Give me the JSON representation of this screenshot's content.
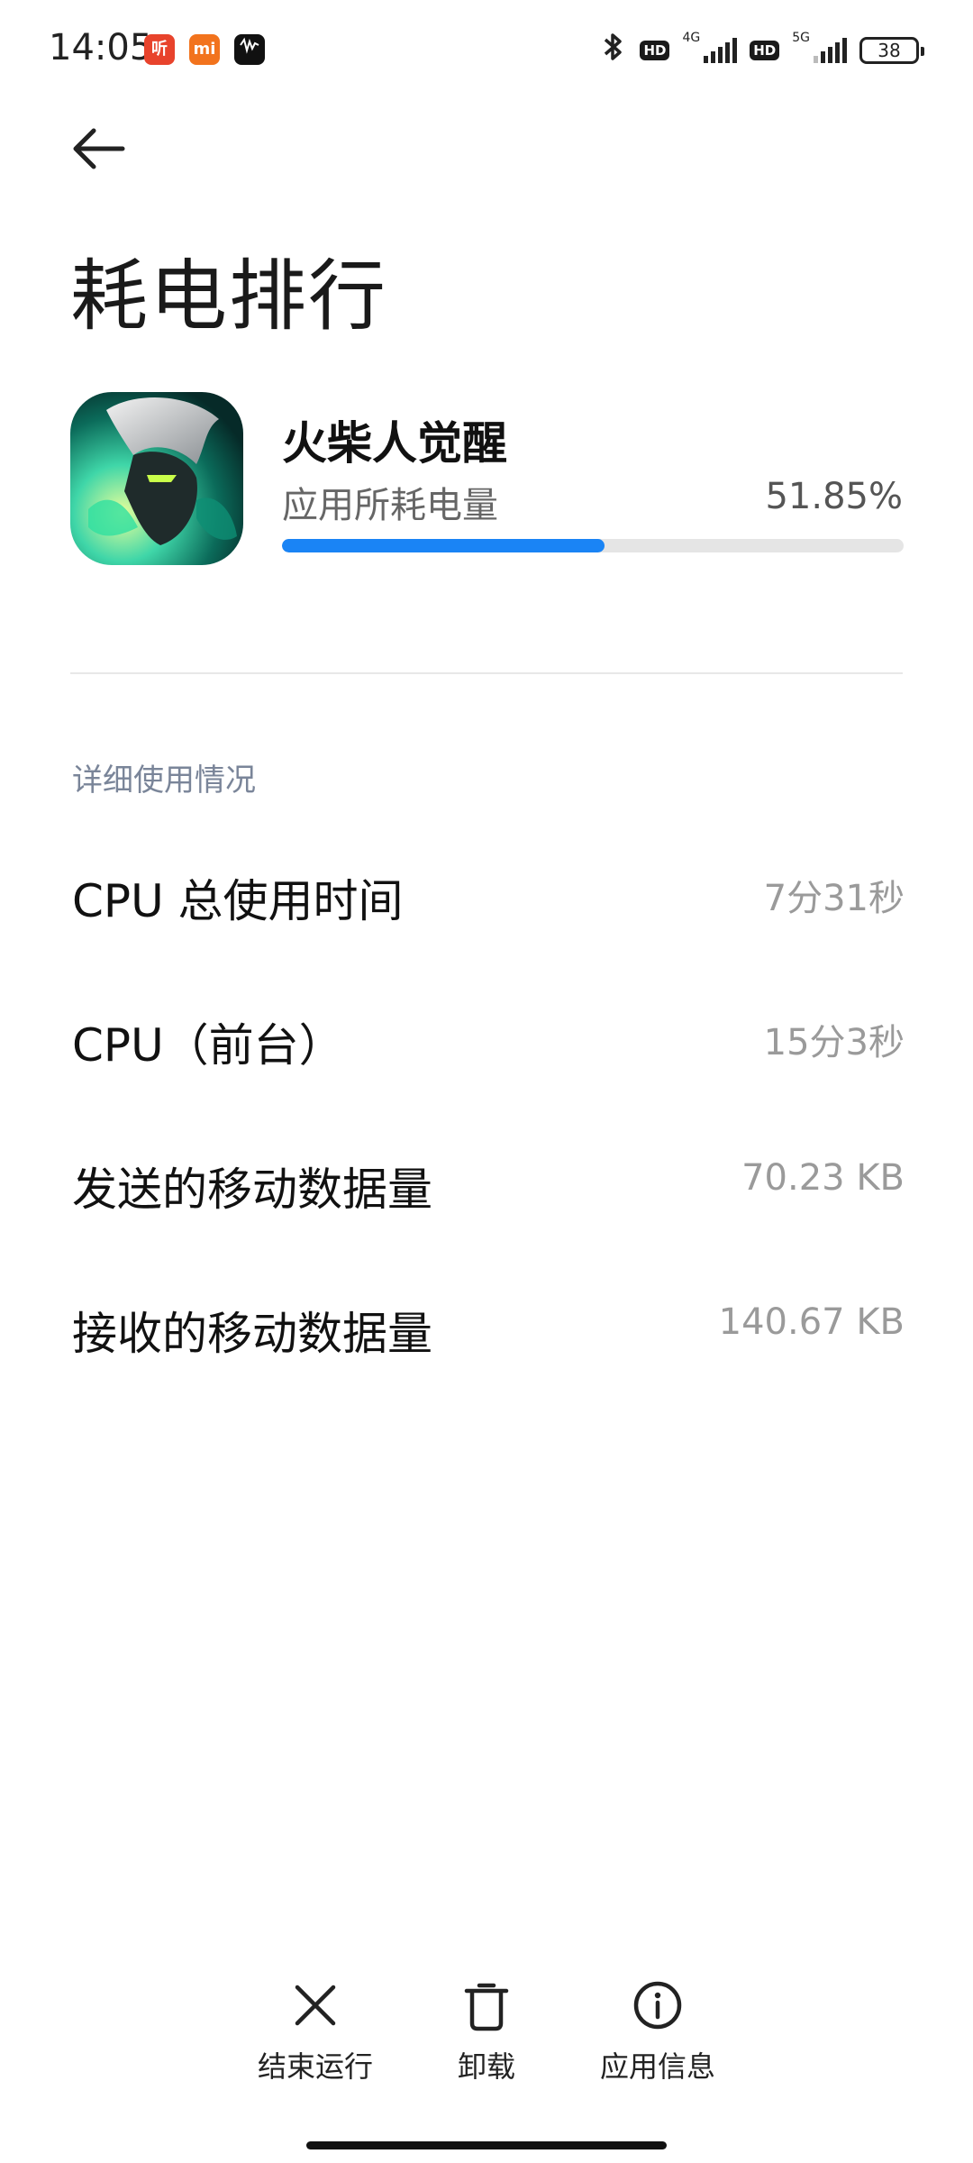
{
  "status_bar": {
    "time": "14:05",
    "notif_icons": [
      "听",
      "mi",
      "视频"
    ],
    "net1": "4G",
    "net2": "5G",
    "hd": "HD",
    "battery": "38"
  },
  "header": {
    "title": "耗电排行"
  },
  "app": {
    "name": "火柴人觉醒",
    "usage_label": "应用所耗电量",
    "usage_percent_text": "51.85%",
    "usage_fraction": 0.5185,
    "accent_color": "#1a84f5"
  },
  "details": {
    "section_title": "详细使用情况",
    "rows": [
      {
        "label": "CPU 总使用时间",
        "value": "7分31秒"
      },
      {
        "label": "CPU（前台）",
        "value": "15分3秒"
      },
      {
        "label": "发送的移动数据量",
        "value": "70.23 KB"
      },
      {
        "label": "接收的移动数据量",
        "value": "140.67 KB"
      }
    ]
  },
  "actions": {
    "stop": "结束运行",
    "uninstall": "卸载",
    "app_info": "应用信息"
  }
}
